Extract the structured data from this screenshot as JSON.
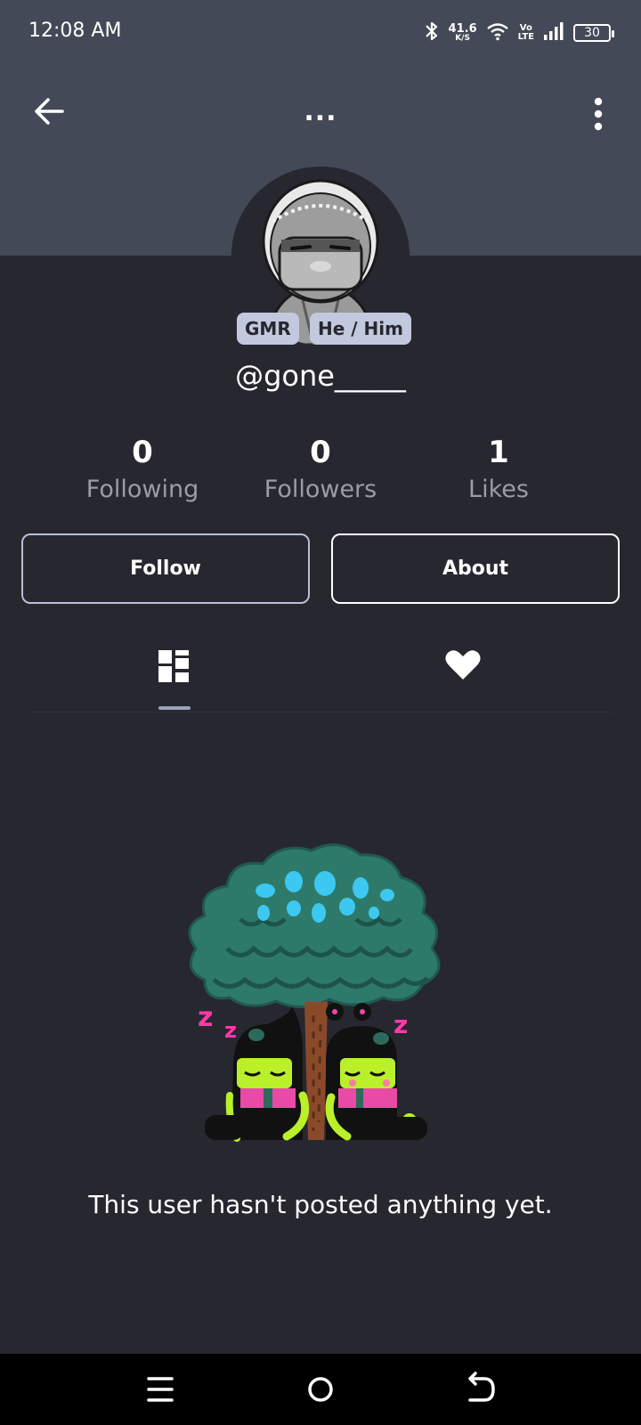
{
  "status_bar": {
    "time": "12:08 AM",
    "net_speed_value": "41.6",
    "net_speed_unit": "K/S",
    "volte_top": "Vo",
    "volte_bottom": "LTE",
    "battery": "30",
    "icons": [
      "bluetooth-icon",
      "wifi-icon",
      "signal-icon",
      "battery-icon"
    ]
  },
  "top_bar": {
    "title": "...",
    "back_icon": "arrow-left-icon",
    "menu_icon": "vertical-dots-icon"
  },
  "profile": {
    "badges": [
      "GMR",
      "He / Him"
    ],
    "username": "@gone_____"
  },
  "stats": [
    {
      "value": "0",
      "label": "Following"
    },
    {
      "value": "0",
      "label": "Followers"
    },
    {
      "value": "1",
      "label": "Likes"
    }
  ],
  "actions": {
    "follow_label": "Follow",
    "about_label": "About"
  },
  "tabs": {
    "items": [
      "posts-grid-icon",
      "heart-icon"
    ],
    "active": "posts-grid-icon"
  },
  "empty_state": {
    "message": "This user hasn't posted anything yet."
  },
  "navbar": {
    "icons": [
      "menu-icon",
      "home-circle-icon",
      "back-icon"
    ]
  },
  "colors": {
    "header_bg": "#434956",
    "page_bg": "#272730",
    "badge_bg": "#c2c8dd",
    "muted_text": "#9a9ca8",
    "follow_border": "#b8c0d6"
  }
}
